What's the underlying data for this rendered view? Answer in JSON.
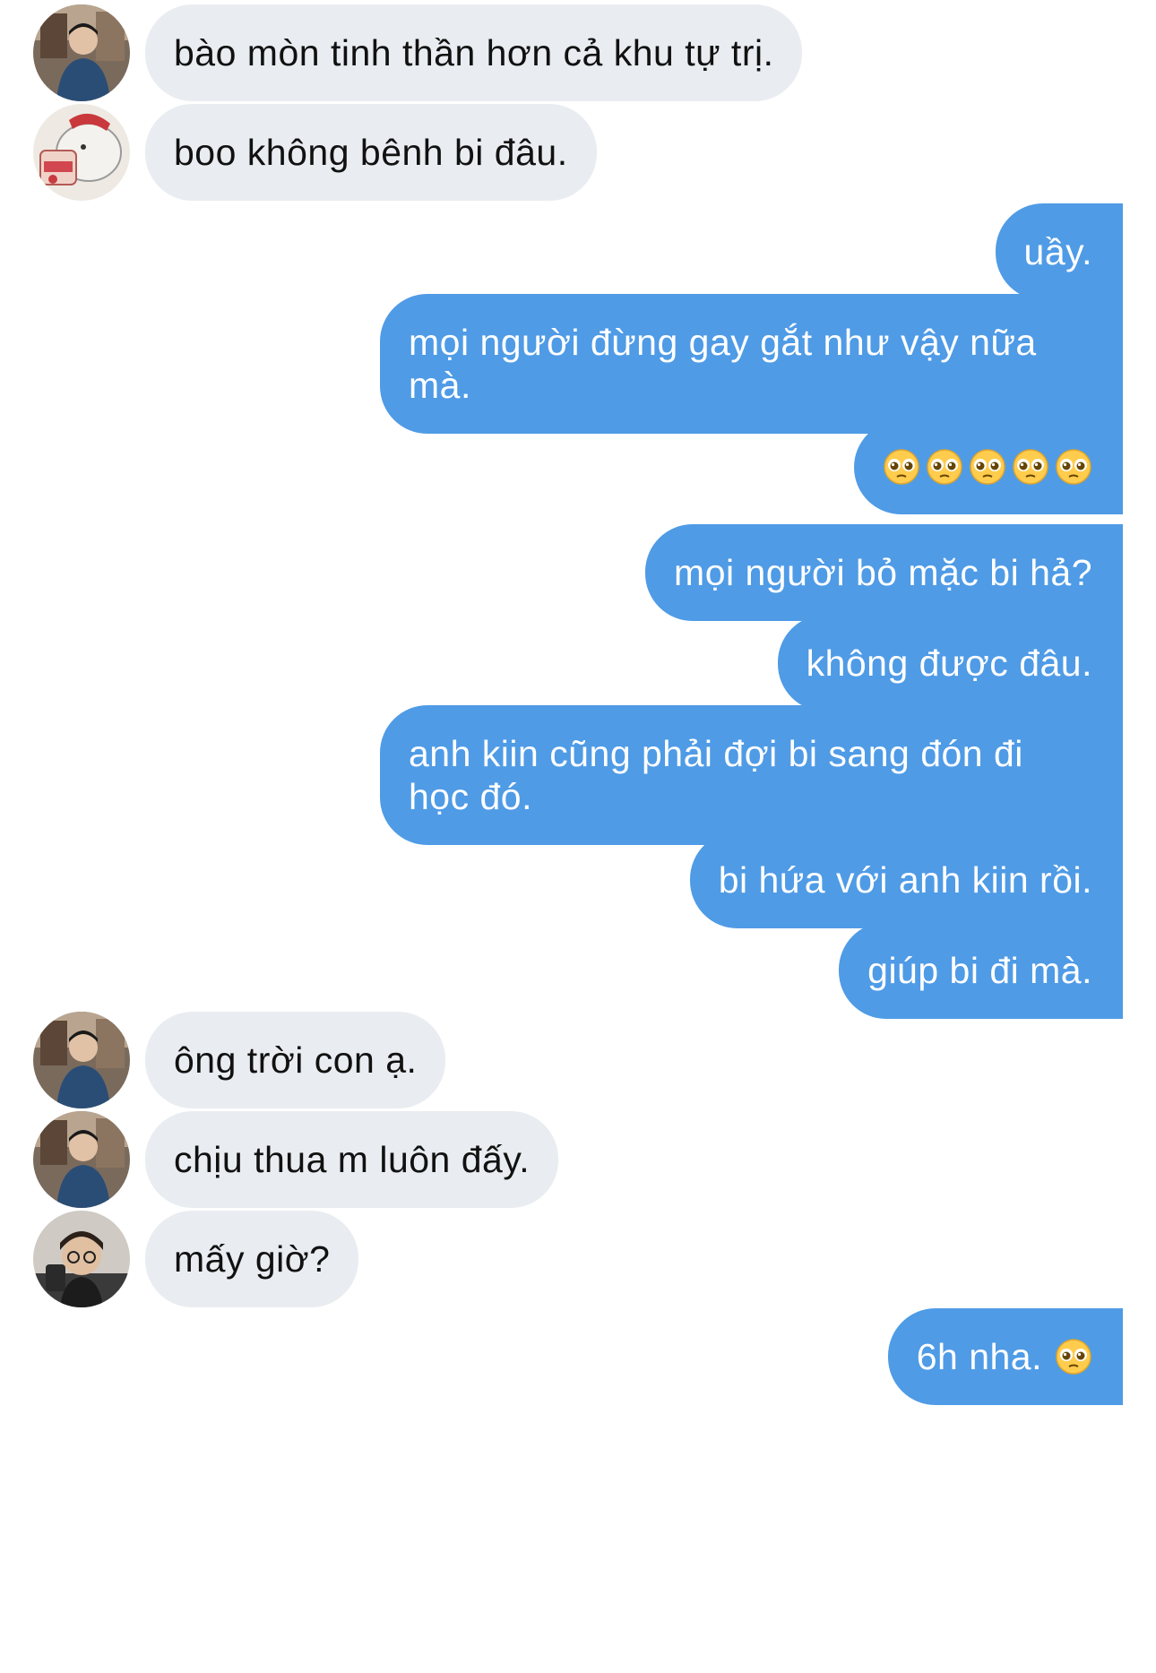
{
  "messages": [
    {
      "side": "in",
      "text": "bào mòn tinh thần hơn cả khu tự trị.",
      "avatar": "avatar-boy-street"
    },
    {
      "side": "in",
      "text": "boo không bênh bi đâu.",
      "avatar": "avatar-bear-cartoon"
    },
    {
      "side": "out",
      "text": "uầy."
    },
    {
      "side": "out",
      "text": "mọi người đừng gay gắt như vậy nữa mà."
    },
    {
      "side": "out",
      "text": "",
      "emoji": [
        "pleading-face-icon",
        "pleading-face-icon",
        "pleading-face-icon",
        "pleading-face-icon",
        "pleading-face-icon"
      ]
    },
    {
      "side": "out",
      "text": "mọi người bỏ mặc bi hả?"
    },
    {
      "side": "out",
      "text": "không được đâu."
    },
    {
      "side": "out",
      "text": "anh kiin cũng phải đợi bi sang đón đi học đó."
    },
    {
      "side": "out",
      "text": "bi hứa với anh kiin rồi."
    },
    {
      "side": "out",
      "text": "giúp bi đi mà."
    },
    {
      "side": "in",
      "text": "ông trời con ạ.",
      "avatar": "avatar-boy-street"
    },
    {
      "side": "in",
      "text": "chịu thua m luôn đấy.",
      "avatar": "avatar-boy-street"
    },
    {
      "side": "in",
      "text": "mấy giờ?",
      "avatar": "avatar-boy-glasses"
    },
    {
      "side": "out",
      "text": "6h nha.",
      "emoji": [
        "pleading-face-icon"
      ]
    }
  ],
  "colors": {
    "incoming_bubble": "#e9ecf0",
    "outgoing_bubble": "#4f9be6",
    "incoming_text": "#111111",
    "outgoing_text": "#ffffff"
  }
}
